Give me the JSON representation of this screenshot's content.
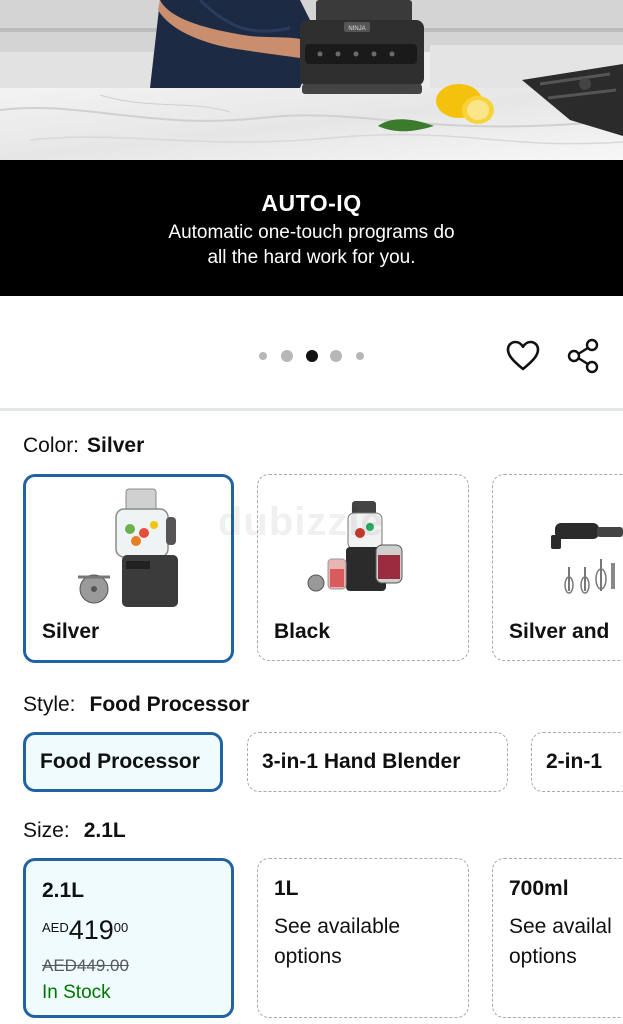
{
  "hero": {
    "title": "AUTO-IQ",
    "subtitle_line1": "Automatic one-touch programs do",
    "subtitle_line2": "all the hard work for you.",
    "appliance_brand": "NINJA"
  },
  "carousel": {
    "dot_count": 5,
    "active_index": 2
  },
  "color": {
    "label": "Color:",
    "selected": "Silver",
    "options": [
      {
        "name": "Silver"
      },
      {
        "name": "Black"
      },
      {
        "name": "Silver and"
      }
    ]
  },
  "style": {
    "label": "Style:",
    "selected": "Food Processor",
    "options": [
      {
        "name": "Food Processor"
      },
      {
        "name": "3-in-1 Hand Blender"
      },
      {
        "name": "2-in-1"
      }
    ]
  },
  "size": {
    "label": "Size:",
    "selected": "2.1L",
    "options": [
      {
        "name": "2.1L",
        "currency": "AED",
        "price_whole": "419",
        "price_fraction": "00",
        "list_price": "AED449.00",
        "stock": "In Stock"
      },
      {
        "name": "1L",
        "desc_line1": "See available",
        "desc_line2": "options"
      },
      {
        "name": "700ml",
        "desc_line1": "See availal",
        "desc_line2": "options"
      }
    ]
  },
  "watermark": "dubizzle",
  "colors": {
    "selected_border": "#2162a1",
    "selected_fill": "#f0fbfd",
    "in_stock": "#007600",
    "banner_bg": "#000000"
  }
}
